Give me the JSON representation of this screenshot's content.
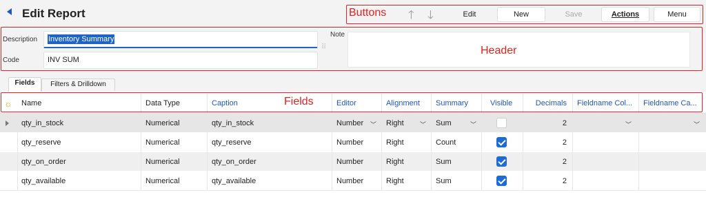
{
  "title": "Edit Report",
  "annotations": {
    "buttons": "Buttons",
    "header": "Header",
    "fields": "Fields"
  },
  "toolbar": {
    "edit": "Edit",
    "new": "New",
    "save": "Save",
    "actions": "Actions",
    "menu": "Menu"
  },
  "header": {
    "description_label": "Description",
    "description_value": "Inventory Summary",
    "code_label": "Code",
    "code_value": "INV SUM",
    "note_label": "Note"
  },
  "tabs": [
    "Fields",
    "Filters & Drilldown"
  ],
  "grid": {
    "columns": [
      "Name",
      "Data Type",
      "Caption",
      "Editor",
      "Alignment",
      "Summary",
      "Visible",
      "Decimals",
      "Fieldname Col...",
      "Fieldname Ca..."
    ],
    "rows": [
      {
        "name": "qty_in_stock",
        "data_type": "Numerical",
        "caption": "qty_in_stock",
        "editor": "Number",
        "alignment": "Right",
        "summary": "Sum",
        "visible": false,
        "decimals": "2"
      },
      {
        "name": "qty_reserve",
        "data_type": "Numerical",
        "caption": "qty_reserve",
        "editor": "Number",
        "alignment": "Right",
        "summary": "Count",
        "visible": true,
        "decimals": "2"
      },
      {
        "name": "qty_on_order",
        "data_type": "Numerical",
        "caption": "qty_on_order",
        "editor": "Number",
        "alignment": "Right",
        "summary": "Sum",
        "visible": true,
        "decimals": "2"
      },
      {
        "name": "qty_available",
        "data_type": "Numerical",
        "caption": "qty_available",
        "editor": "Number",
        "alignment": "Right",
        "summary": "Sum",
        "visible": true,
        "decimals": "2"
      }
    ]
  },
  "colors": {
    "accent": "#1e55c8",
    "annotation": "#e8201f",
    "checkbox": "#1e6bd6"
  },
  "icons": {
    "back": "back-arrow-icon",
    "up": "arrow-up-icon",
    "down": "arrow-down-icon",
    "new_row": "sun-icon",
    "row_pointer": "row-pointer-icon"
  }
}
